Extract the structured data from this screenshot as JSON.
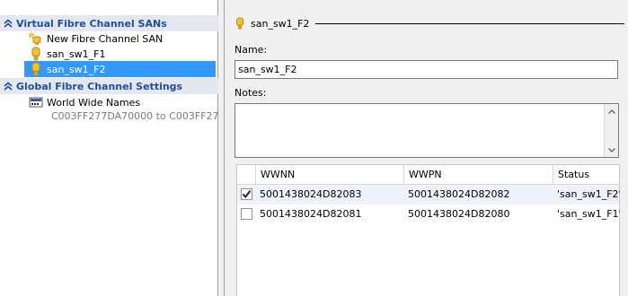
{
  "sidebar": {
    "san_section_title": "Virtual Fibre Channel SANs",
    "san_items": [
      {
        "label": "New Fibre Channel SAN",
        "icon": "new-san-icon"
      },
      {
        "label": "san_sw1_F1",
        "icon": "san-switch-icon"
      },
      {
        "label": "san_sw1_F2",
        "icon": "san-switch-icon",
        "selected": true
      }
    ],
    "global_section_title": "Global Fibre Channel Settings",
    "global_items": [
      {
        "label": "World Wide Names",
        "detail": "C003FF277DA70000 to C003FF27...",
        "icon": "wwn-icon"
      }
    ]
  },
  "detail": {
    "title": "san_sw1_F2",
    "name_label": "Name:",
    "name_value": "san_sw1_F2",
    "notes_label": "Notes:",
    "notes_value": ""
  },
  "grid": {
    "columns": [
      "WWNN",
      "WWPN",
      "Status"
    ],
    "rows": [
      {
        "checked": true,
        "wwnn": "5001438024D82083",
        "wwpn": "5001438024D82082",
        "status": "'san_sw1_F2'"
      },
      {
        "checked": false,
        "wwnn": "5001438024D82081",
        "wwpn": "5001438024D82080",
        "status": "'san_sw1_F1'"
      }
    ]
  },
  "colors": {
    "section_header_bg": "#e3e8f0",
    "section_header_text": "#1f4e9e",
    "selection_bg": "#3399ff",
    "icon_yellow": "#f2c230"
  }
}
